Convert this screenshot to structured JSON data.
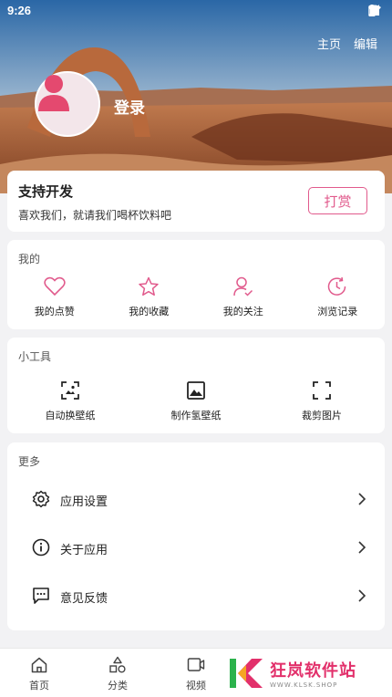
{
  "status_bar": {
    "time": "9:26"
  },
  "header": {
    "nav_home": "主页",
    "nav_edit": "编辑",
    "login_label": "登录"
  },
  "support": {
    "title": "支持开发",
    "description": "喜欢我们，就请我们喝杯饮料吧",
    "tip_button": "打赏"
  },
  "mine": {
    "title": "我的",
    "items": [
      {
        "label": "我的点赞",
        "icon": "heart-icon"
      },
      {
        "label": "我的收藏",
        "icon": "star-icon"
      },
      {
        "label": "我的关注",
        "icon": "user-follow-icon"
      },
      {
        "label": "浏览记录",
        "icon": "history-clock-icon"
      }
    ]
  },
  "tools": {
    "title": "小工具",
    "items": [
      {
        "label": "自动换壁纸",
        "icon": "auto-wallpaper-icon"
      },
      {
        "label": "制作氢壁纸",
        "icon": "image-icon"
      },
      {
        "label": "裁剪图片",
        "icon": "crop-icon"
      }
    ]
  },
  "more": {
    "title": "更多",
    "items": [
      {
        "label": "应用设置",
        "icon": "gear-icon"
      },
      {
        "label": "关于应用",
        "icon": "info-icon"
      },
      {
        "label": "意见反馈",
        "icon": "feedback-icon"
      }
    ]
  },
  "bottom_nav": [
    {
      "label": "首页",
      "icon": "home-icon"
    },
    {
      "label": "分类",
      "icon": "category-icon"
    },
    {
      "label": "视频",
      "icon": "video-icon"
    }
  ],
  "watermark": {
    "brand": "狂岚软件站",
    "url": "WWW.KLSK.SHOP"
  },
  "colors": {
    "accent": "#e15a8c",
    "background": "#f2f2f4"
  }
}
